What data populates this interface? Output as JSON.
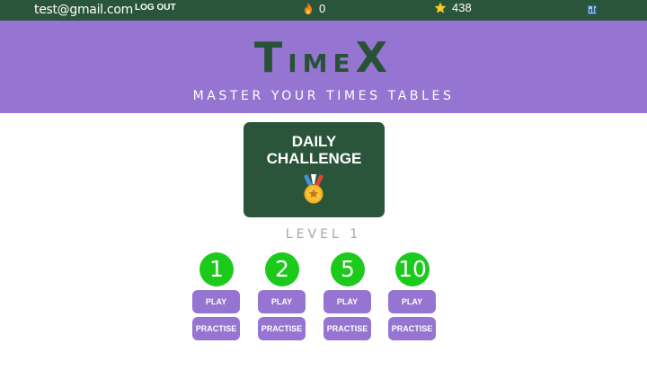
{
  "topbar": {
    "email": "test@gmail.com",
    "logout_label": "LOG OUT",
    "streak_icon": "fire-icon",
    "streak_count": "0",
    "stars_icon": "star-icon",
    "stars_count": "438",
    "chart_icon": "bar-chart-icon"
  },
  "header": {
    "logo_big_1": "T",
    "logo_small": "IME",
    "logo_big_2": "X",
    "tagline": "MASTER YOUR TIMES TABLES",
    "background": "#9575d1",
    "logo_color": "#285236"
  },
  "daily_challenge": {
    "line1": "DAILY",
    "line2": "CHALLENGE",
    "icon": "medal-icon"
  },
  "level_label": "LEVEL 1",
  "tables": [
    {
      "number": "1",
      "play_label": "PLAY",
      "practise_label": "PRACTISE"
    },
    {
      "number": "2",
      "play_label": "PLAY",
      "practise_label": "PRACTISE"
    },
    {
      "number": "5",
      "play_label": "PLAY",
      "practise_label": "PRACTISE"
    },
    {
      "number": "10",
      "play_label": "PLAY",
      "practise_label": "PRACTISE"
    }
  ],
  "colors": {
    "topbar": "#2a553a",
    "accent_green": "#1bca1b",
    "button_purple": "#9575d1"
  }
}
